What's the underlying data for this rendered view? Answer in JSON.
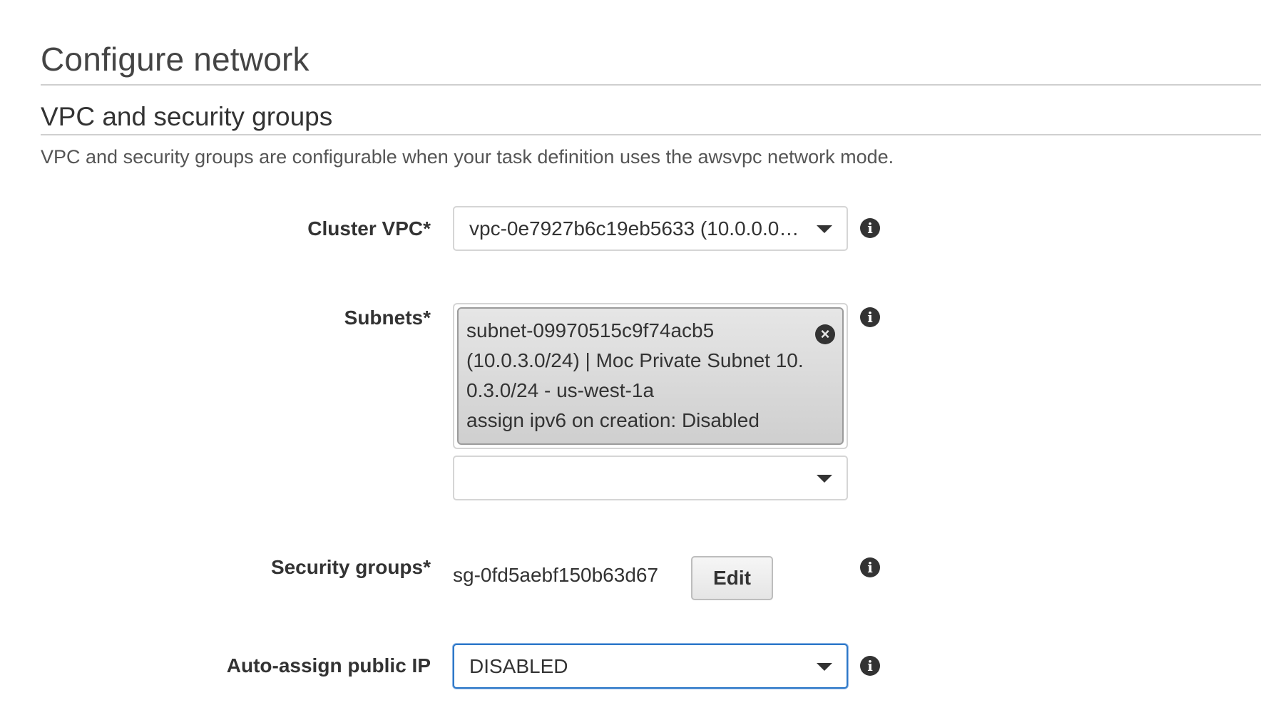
{
  "page": {
    "title": "Configure network",
    "section_title": "VPC and security groups",
    "section_description": "VPC and security groups are configurable when your task definition uses the awsvpc network mode."
  },
  "cluster_vpc": {
    "label": "Cluster VPC*",
    "value": "vpc-0e7927b6c19eb5633 (10.0.0.0/16)",
    "icon": "chevron-down-icon"
  },
  "subnets": {
    "label": "Subnets*",
    "selected": [
      {
        "lines": [
          "subnet-09970515c9f74acb5",
          "(10.0.3.0/24) | Moc Private Subnet 10.",
          "0.3.0/24 - us-west-1a",
          "assign ipv6 on creation: Disabled"
        ],
        "remove_glyph": "×",
        "remove_icon": "close-circle-icon"
      }
    ],
    "add_select_value": ""
  },
  "security_groups": {
    "label": "Security groups*",
    "value": "sg-0fd5aebf150b63d67",
    "edit_label": "Edit"
  },
  "auto_assign_public_ip": {
    "label": "Auto-assign public IP",
    "value": "DISABLED",
    "focused": true
  },
  "info_icon": {
    "glyph": "i",
    "name": "info-icon"
  },
  "colors": {
    "focus_border": "#2d78c8",
    "token_bg": "#dcdcdc",
    "text": "#333333"
  }
}
